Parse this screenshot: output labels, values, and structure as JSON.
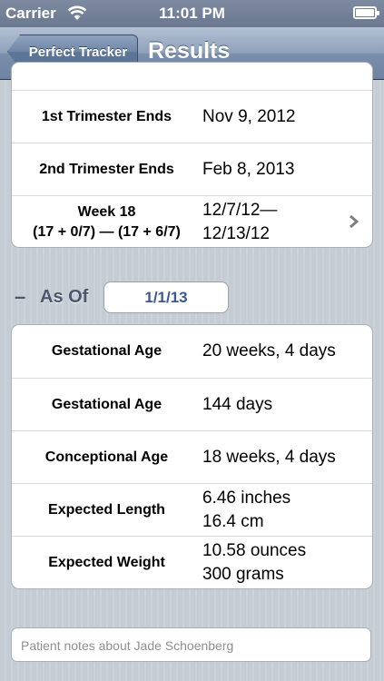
{
  "status_bar": {
    "carrier": "Carrier",
    "time": "11:01 PM"
  },
  "nav": {
    "back_label": "Perfect Tracker",
    "title": "Results"
  },
  "trimester_rows": [
    {
      "label": "1st Trimester Ends",
      "value": "Nov 9, 2012"
    },
    {
      "label": "2nd Trimester Ends",
      "value": "Feb 8, 2013"
    },
    {
      "label_line1": "Week 18",
      "label_line2": "(17 + 0/7) — (17 + 6/7)",
      "value_line1": "12/7/12—",
      "value_line2": "12/13/12"
    }
  ],
  "as_of": {
    "toggle": "–",
    "label": "As Of",
    "date": "1/1/13"
  },
  "age_rows": [
    {
      "label": "Gestational Age",
      "value": "20 weeks, 4 days"
    },
    {
      "label": "Gestational Age",
      "value": "144 days"
    },
    {
      "label": "Conceptional Age",
      "value": "18 weeks, 4 days"
    },
    {
      "label": "Expected Length",
      "value_line1": "6.46 inches",
      "value_line2": "16.4 cm"
    },
    {
      "label": "Expected Weight",
      "value_line1": "10.58 ounces",
      "value_line2": "300 grams"
    }
  ],
  "notes": {
    "placeholder": "Patient notes about Jade Schoenberg"
  }
}
